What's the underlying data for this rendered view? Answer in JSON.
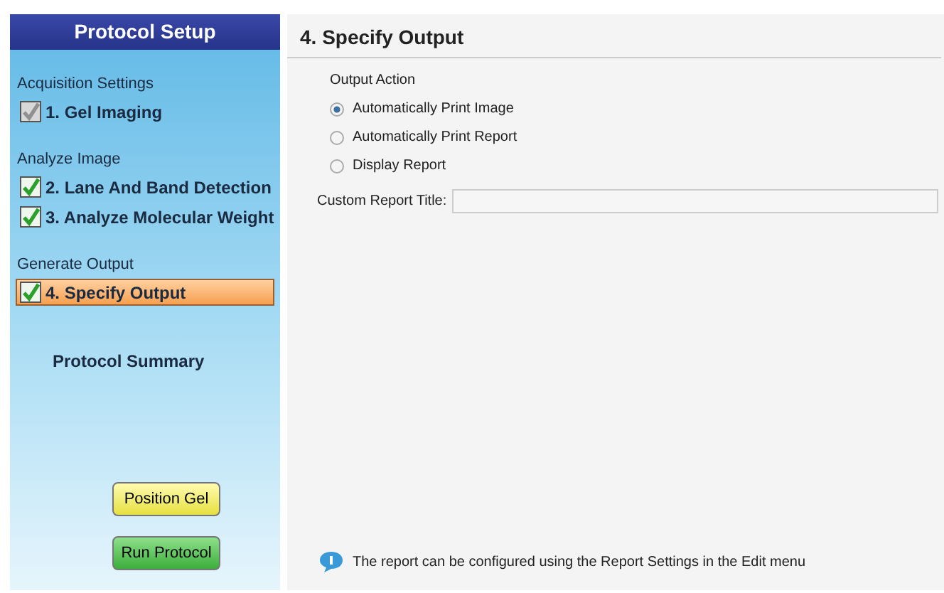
{
  "sidebar": {
    "title": "Protocol Setup",
    "groups": [
      {
        "label": "Acquisition Settings",
        "steps": [
          {
            "label": "1. Gel Imaging",
            "checked": true,
            "disabled": true,
            "selected": false
          }
        ]
      },
      {
        "label": "Analyze Image",
        "steps": [
          {
            "label": "2. Lane And Band Detection",
            "checked": true,
            "disabled": false,
            "selected": false
          },
          {
            "label": "3. Analyze Molecular Weight",
            "checked": true,
            "disabled": false,
            "selected": false
          }
        ]
      },
      {
        "label": "Generate Output",
        "steps": [
          {
            "label": "4. Specify Output",
            "checked": true,
            "disabled": false,
            "selected": true
          }
        ]
      }
    ],
    "summary": "Protocol Summary",
    "buttons": [
      {
        "label": "Position Gel",
        "kind": "yellow"
      },
      {
        "label": "Run Protocol",
        "kind": "green"
      }
    ]
  },
  "main": {
    "title": "4. Specify Output",
    "section": "Output Action",
    "options": [
      {
        "label": "Automatically Print Image",
        "selected": true
      },
      {
        "label": "Automatically Print Report",
        "selected": false
      },
      {
        "label": "Display Report",
        "selected": false
      }
    ],
    "field_label": "Custom Report Title:",
    "info": "The report can be configured using the Report Settings in the Edit menu"
  }
}
